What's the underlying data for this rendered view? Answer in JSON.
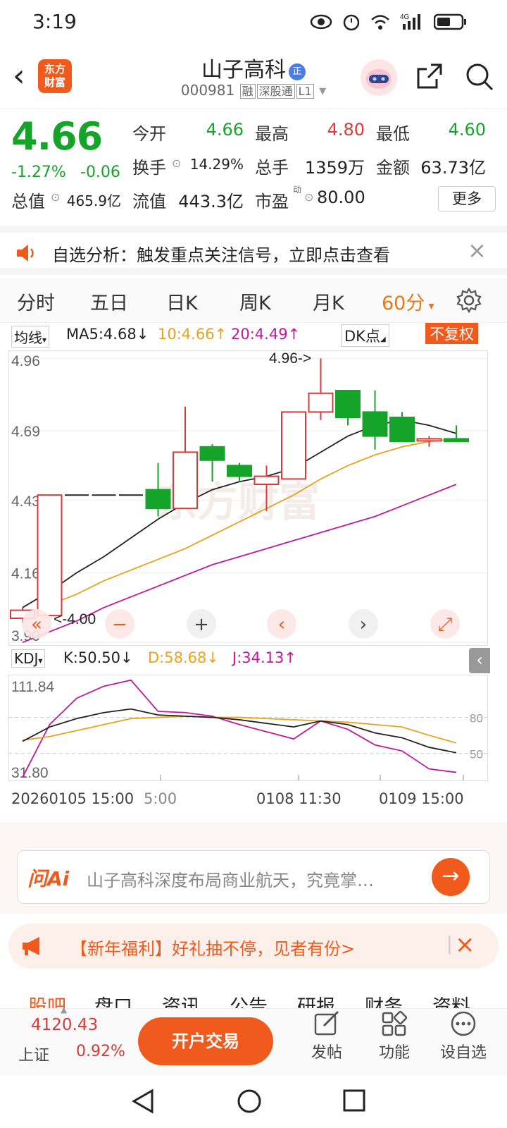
{
  "status": {
    "time": "3:19",
    "net": "4G"
  },
  "header": {
    "name": "山子高科",
    "name_badge": "正",
    "code": "000981",
    "tags": [
      "融",
      "深股通",
      "L1"
    ],
    "logo": "东方财富"
  },
  "quote": {
    "price": "4.66",
    "pct": "-1.27%",
    "chg": "-0.06",
    "open_label": "今开",
    "open": "4.66",
    "high_label": "最高",
    "high": "4.80",
    "low_label": "最低",
    "low": "4.60",
    "turnover_label": "换手",
    "turnover": "14.29%",
    "volume_label": "总手",
    "volume": "1359万",
    "amount_label": "金额",
    "amount": "63.73亿",
    "mktcap_label": "总值",
    "mktcap": "465.9亿",
    "float_label": "流值",
    "float": "443.3亿",
    "pe_label": "市盈",
    "pe_sup": "动",
    "pe": "80.00",
    "more": "更多"
  },
  "notice": {
    "text": "自选分析：触发重点关注信号，立即点击查看"
  },
  "tabs": [
    "分时",
    "五日",
    "日K",
    "周K",
    "月K",
    "60分"
  ],
  "ma": {
    "type": "均线",
    "ma5": "MA5:4.68",
    "ma10": "10:4.66",
    "ma20": "20:4.49",
    "dk": "DK点",
    "fq": "不复权"
  },
  "kdj": {
    "type": "KDJ",
    "k": "K:50.50",
    "d": "D:58.68",
    "j": "J:34.13"
  },
  "chart_data": [
    {
      "type": "candlestick",
      "title": "60分K线",
      "y_ticks": [
        "4.96",
        "4.69",
        "4.43",
        "4.16",
        "3.90"
      ],
      "annotations": [
        "4.96->",
        "<-4.00"
      ],
      "x_ticks": [
        "20260105 15:00",
        "5:00",
        "0108 11:30",
        "0109 15:00"
      ],
      "candles": [
        {
          "o": 3.99,
          "c": 4.02,
          "h": 4.03,
          "l": 3.97
        },
        {
          "o": 4.0,
          "c": 4.45,
          "h": 4.45,
          "l": 4.0
        },
        {
          "o": 4.45,
          "c": 4.45,
          "h": 4.45,
          "l": 4.45
        },
        {
          "o": 4.45,
          "c": 4.45,
          "h": 4.45,
          "l": 4.45
        },
        {
          "o": 4.45,
          "c": 4.45,
          "h": 4.45,
          "l": 4.45
        },
        {
          "o": 4.47,
          "c": 4.4,
          "h": 4.57,
          "l": 4.37
        },
        {
          "o": 4.4,
          "c": 4.61,
          "h": 4.78,
          "l": 4.4
        },
        {
          "o": 4.63,
          "c": 4.58,
          "h": 4.64,
          "l": 4.5
        },
        {
          "o": 4.56,
          "c": 4.52,
          "h": 4.57,
          "l": 4.5
        },
        {
          "o": 4.49,
          "c": 4.52,
          "h": 4.56,
          "l": 4.39
        },
        {
          "o": 4.51,
          "c": 4.76,
          "h": 4.76,
          "l": 4.51
        },
        {
          "o": 4.76,
          "c": 4.83,
          "h": 4.96,
          "l": 4.73
        },
        {
          "o": 4.84,
          "c": 4.74,
          "h": 4.84,
          "l": 4.71
        },
        {
          "o": 4.76,
          "c": 4.67,
          "h": 4.84,
          "l": 4.62
        },
        {
          "o": 4.74,
          "c": 4.65,
          "h": 4.76,
          "l": 4.65
        },
        {
          "o": 4.66,
          "c": 4.66,
          "h": 4.67,
          "l": 4.63
        },
        {
          "o": 4.66,
          "c": 4.65,
          "h": 4.71,
          "l": 4.65
        }
      ],
      "ma5": [
        4.03,
        4.09,
        4.16,
        4.22,
        4.29,
        4.36,
        4.42,
        4.47,
        4.5,
        4.52,
        4.55,
        4.61,
        4.67,
        4.71,
        4.73,
        4.71,
        4.68
      ],
      "ma10": [
        4.0,
        4.04,
        4.08,
        4.13,
        4.17,
        4.21,
        4.25,
        4.3,
        4.35,
        4.4,
        4.45,
        4.51,
        4.56,
        4.6,
        4.63,
        4.65,
        4.66
      ],
      "ma20": [
        3.9,
        3.94,
        3.98,
        4.03,
        4.07,
        4.11,
        4.15,
        4.19,
        4.22,
        4.25,
        4.28,
        4.31,
        4.34,
        4.37,
        4.41,
        4.45,
        4.49
      ]
    },
    {
      "type": "line",
      "title": "KDJ",
      "y_ticks": [
        "111.84",
        "31.80"
      ],
      "right_ticks": [
        "80",
        "50"
      ],
      "K": [
        60,
        72,
        79,
        84,
        87,
        82,
        81,
        80,
        78,
        75,
        72,
        77,
        74,
        67,
        63,
        55,
        50.5
      ],
      "D": [
        61,
        64,
        69,
        74,
        79,
        80,
        81,
        80,
        80,
        79,
        78,
        77,
        76,
        74,
        72,
        65,
        58.68
      ],
      "J": [
        30,
        74,
        96,
        106,
        111,
        85,
        84,
        81,
        74,
        68,
        62,
        77,
        70,
        57,
        52,
        37,
        34.13
      ]
    }
  ],
  "ai": {
    "logo": "问Ai",
    "text": "山子高科深度布局商业航天，究竟掌…"
  },
  "promo": {
    "text": "【新年福利】好礼抽不停，见者有份>"
  },
  "subtabs": [
    "股吧",
    "盘口",
    "资讯",
    "公告",
    "研报",
    "财务",
    "资料"
  ],
  "bottom": {
    "index_val": "4120.43",
    "index_name": "上证",
    "index_pct": "0.92%",
    "trade": "开户交易",
    "post": "发帖",
    "func": "功能",
    "watch": "设自选"
  },
  "colors": {
    "up": "#d83a3a",
    "down": "#16a329",
    "accent": "#e67a18",
    "ma5": "#222222",
    "ma10": "#e8a21e",
    "ma20": "#c0199c"
  }
}
